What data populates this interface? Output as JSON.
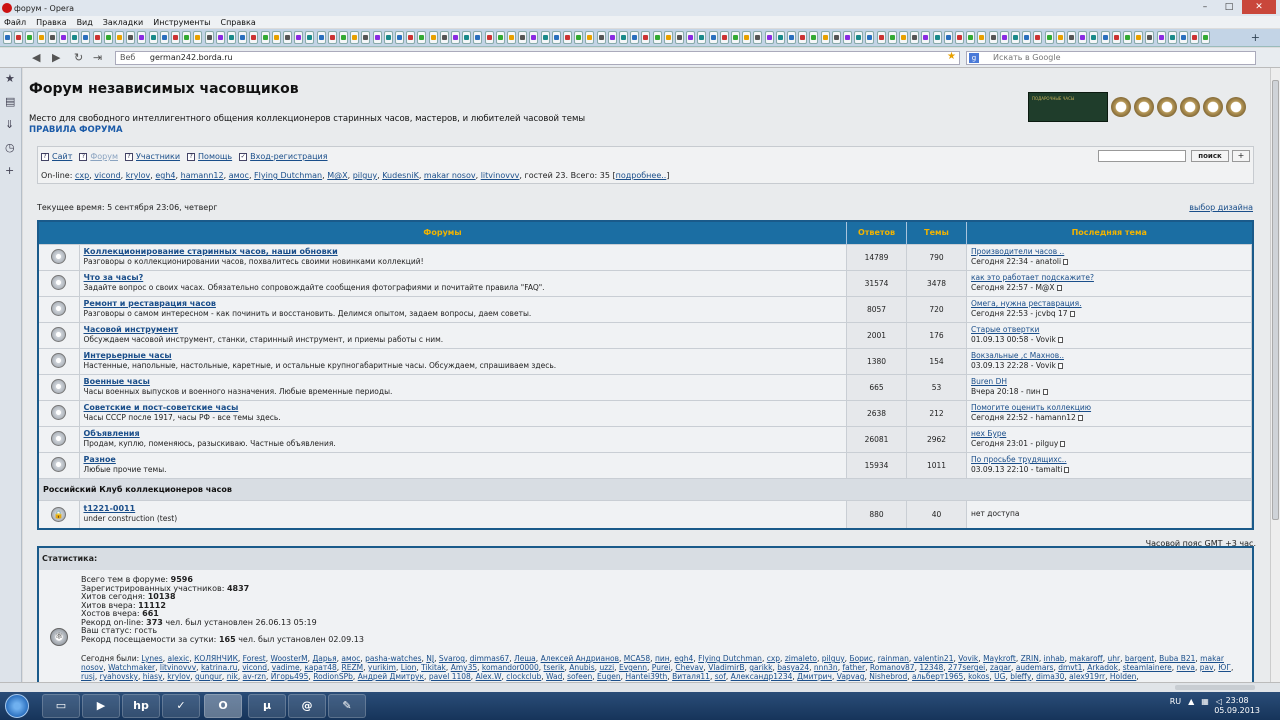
{
  "window": {
    "title": "форум - Opera"
  },
  "menu": [
    "Файл",
    "Правка",
    "Вид",
    "Закладки",
    "Инструменты",
    "Справка"
  ],
  "address": {
    "scheme_label": "Веб",
    "url": "german242.borda.ru",
    "search_placeholder": "Искать в Google"
  },
  "header": {
    "title": "Форум независимых часовщиков",
    "description": "Место для свободного интеллигентного общения коллекционеров старинных часов, мастеров, и любителей часовой темы",
    "rules": "ПРАВИЛА ФОРУМА",
    "banner_text": "ПОДАРОЧНЫЕ ЧАСЫ"
  },
  "nav": {
    "links": [
      {
        "label": "Сайт",
        "icon": "?"
      },
      {
        "label": "Форум",
        "icon": "?"
      },
      {
        "label": "Участники",
        "icon": "?"
      },
      {
        "label": "Помощь",
        "icon": "?"
      },
      {
        "label": "Вход-регистрация",
        "icon": "✓"
      }
    ],
    "search_button": "поиск",
    "plus_button": "+",
    "online_prefix": "On-line:",
    "online_users": [
      "cxp",
      "vicond",
      "krylov",
      "egh4",
      "hamann12",
      "амос",
      "Flying Dutchman",
      "M@X",
      "pilguy",
      "KudesniK",
      "makar nosov",
      "litvinovvv"
    ],
    "online_suffix": "гостей 23. Всего: 35",
    "online_more": "подробнее.."
  },
  "current_time": "Текущее время: 5 сентября 23:06, четверг",
  "design_link": "выбор дизайна",
  "table": {
    "headers": {
      "forums": "Форумы",
      "replies": "Ответов",
      "topics": "Темы",
      "last": "Последняя тема"
    },
    "rows": [
      {
        "name": "Коллекционирование старинных часов, наши обновки",
        "desc": "Разговоры о коллекционировании часов, похвалитесь своими новинками коллекций!",
        "replies": "14789",
        "topics": "790",
        "last_title": "Производители часов ..",
        "last_info": "Сегодня 22:34 - anatoli"
      },
      {
        "name": "Что за часы?",
        "desc": "Задайте вопрос о своих часах. Обязательно сопровождайте сообщения фотографиями и почитайте правила \"FAQ\".",
        "replies": "31574",
        "topics": "3478",
        "last_title": "как это работает подскажите?",
        "last_info": "Сегодня 22:57 - M@X"
      },
      {
        "name": "Ремонт и реставрация часов",
        "desc": "Разговоры о самом интересном - как починить и восстановить. Делимся опытом, задаем вопросы, даем советы.",
        "replies": "8057",
        "topics": "720",
        "last_title": "Омега, нужна реставрация.",
        "last_info": "Сегодня 22:53 - jcvbq 17"
      },
      {
        "name": "Часовой инструмент",
        "desc": "Обсуждаем часовой инструмент, станки, старинный инструмент, и приемы работы с ним.",
        "replies": "2001",
        "topics": "176",
        "last_title": "Старые отвертки",
        "last_info": "01.09.13 00:58 - Vovik"
      },
      {
        "name": "Интерьерные часы",
        "desc": "Настенные, напольные, настольные, каретные, и остальные крупногабаритные часы. Обсуждаем, спрашиваем здесь.",
        "replies": "1380",
        "topics": "154",
        "last_title": "Вокзальные ,с Махнов..",
        "last_info": "03.09.13 22:28 - Vovik"
      },
      {
        "name": "Военные часы",
        "desc": "Часы военных выпусков и военного назначения. Любые временные периоды.",
        "replies": "665",
        "topics": "53",
        "last_title": "Buren DH",
        "last_info": "Вчера 20:18 - пин"
      },
      {
        "name": "Советские и пост-советские часы",
        "desc": "Часы СССР после 1917, часы РФ - все темы здесь.",
        "replies": "2638",
        "topics": "212",
        "last_title": "Помогите оценить коллекцию",
        "last_info": "Сегодня 22:52 - hamann12"
      },
      {
        "name": "Объявления",
        "desc": "Продам, куплю, поменяюсь, разыскиваю. Частные объявления.",
        "replies": "26081",
        "topics": "2962",
        "last_title": "нех Буре",
        "last_info": "Сегодня 23:01 - pilguy"
      },
      {
        "name": "Разное",
        "desc": "Любые прочие темы.",
        "replies": "15934",
        "topics": "1011",
        "last_title": "По просьбе трудящихс..",
        "last_info": "03.09.13 22:10 - tamalti"
      }
    ],
    "category": "Российский Клуб коллекционеров часов",
    "locked": {
      "name": "t1221-0011",
      "desc": "under construction (test)",
      "replies": "880",
      "topics": "40",
      "last": "нет доступа"
    }
  },
  "timezone": "Часовой пояс GMT +3 час.",
  "stats": {
    "title": "Статистика:",
    "lines": [
      {
        "label": "Всего тем в форуме:",
        "value": "9596",
        "suffix": ""
      },
      {
        "label": "Зарегистрированных участников:",
        "value": "4837",
        "suffix": ""
      },
      {
        "label": "Хитов сегодня:",
        "value": "10138",
        "suffix": ""
      },
      {
        "label": "Хитов вчера:",
        "value": "11112",
        "suffix": ""
      },
      {
        "label": "Хостов вчера:",
        "value": "661",
        "suffix": ""
      },
      {
        "label": "Рекорд on-line:",
        "value": "373",
        "suffix": "чел. был установлен 26.06.13 05:19"
      },
      {
        "label": "Ваш статус:",
        "value": "",
        "suffix": "гость"
      },
      {
        "label": "Рекорд посещаемости за сутки:",
        "value": "165",
        "suffix": "чел. был установлен 02.09.13"
      }
    ],
    "today_label": "Сегодня были:",
    "today_users": [
      "Lynes",
      "alexic",
      "КОЛЯНЧИК",
      "Forest",
      "WoosterM",
      "Дарья",
      "амос",
      "pasha-watches",
      "NJ",
      "Svarog",
      "dimmas67",
      "Леша",
      "Алексей Андрианов",
      "MCA58",
      "пин",
      "egh4",
      "Flying Dutchman",
      "cxp",
      "zimaleto",
      "pilguy",
      "Борис",
      "rainman",
      "valentin21",
      "Vovik",
      "Maykroft",
      "ZRIN",
      "inhab",
      "makaroff",
      "uhr",
      "bargent",
      "Buba B21",
      "makar nosov",
      "Watchmaker",
      "litvinovvv",
      "katrina.ru",
      "vicond",
      "vadime",
      "карат48",
      "REZM",
      "yurikim",
      "Lion",
      "Tikitak",
      "Amy35",
      "komandor0000",
      "tserik",
      "Anubis",
      "uzzi",
      "Evgenn",
      "Purei",
      "Chevav",
      "VladimirB",
      "garikk",
      "basya24",
      "nnn3n",
      "father",
      "Romanov87",
      "12348",
      "277sergei",
      "zagar",
      "audemars",
      "dmvt1",
      "Arkadok",
      "steamlainere",
      "neva",
      "pav",
      "ЮГ",
      "rusj",
      "ryahovsky",
      "hiasy",
      "krylov",
      "gungur",
      "nik",
      "av-rzn",
      "Игорь495",
      "RodionSPb",
      "Андрей Дмитрук",
      "pavel 1108",
      "Alex.W",
      "clockclub",
      "Wad",
      "sofeen",
      "Eugen",
      "Hantei39th",
      "Виталя11",
      "sof",
      "Александр1234",
      "Дмитрич",
      "Vapvag",
      "Nishebrod",
      "альберт1965",
      "kokos",
      "UG",
      "bleffy",
      "dima30",
      "alex919rr",
      "Holden"
    ]
  },
  "taskbar": {
    "lang": "RU",
    "time": "23:08",
    "date": "05.09.2013"
  },
  "colors": {
    "header_bg": "#1b6ea3",
    "header_text": "#f2b400",
    "link": "#1a4e8a",
    "border": "#1a5a8a"
  }
}
